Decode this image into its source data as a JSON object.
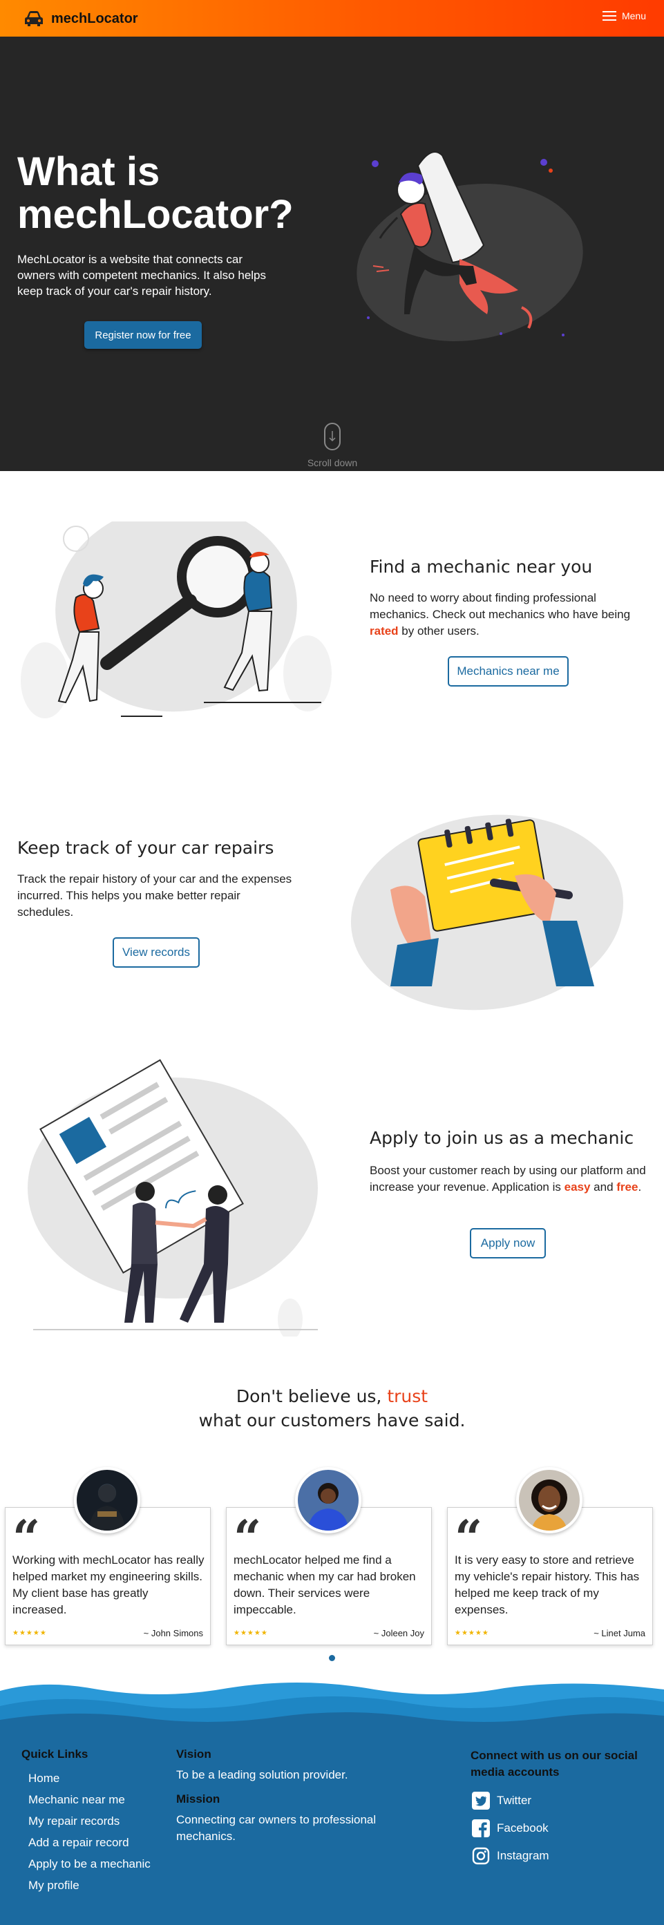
{
  "nav": {
    "brand": "mechLocator",
    "menu_label": "Menu"
  },
  "hero": {
    "title_line1": "What is",
    "title_line2": "mechLocator?",
    "description": "MechLocator is a website that connects car owners with competent mechanics. It also helps keep track of your car's repair history.",
    "cta": "Register now for free",
    "scroll_label": "Scroll down"
  },
  "find": {
    "heading": "Find a mechanic near you",
    "text_before": "No need to worry about finding professional mechanics. Check out mechanics who have being ",
    "text_highlight": "rated",
    "text_after": " by other users.",
    "button": "Mechanics near me"
  },
  "track": {
    "heading": "Keep track of your car repairs",
    "text": "Track the repair history of your car and the expenses incurred. This helps you make better repair schedules.",
    "button": "View records"
  },
  "apply": {
    "heading": "Apply to join us as a mechanic",
    "text_before": "Boost your customer reach by using our platform and increase your revenue. Application is ",
    "highlight1": "easy",
    "text_mid": " and ",
    "highlight2": "free",
    "text_after": ".",
    "button": "Apply now"
  },
  "testimonials": {
    "heading_before": "Don't believe us, ",
    "heading_highlight": "trust",
    "heading_after": " what our customers have said.",
    "quote_glyph": "“",
    "items": [
      {
        "text": "Working with mechLocator has really helped market my engineering skills. My client base has greatly increased.",
        "stars": "★★★★★",
        "author": "~ John Simons"
      },
      {
        "text": "mechLocator helped me find a mechanic when my car had broken down. Their services were impeccable.",
        "stars": "★★★★★",
        "author": "~ Joleen Joy"
      },
      {
        "text": "It is very easy to store and retrieve my vehicle's repair history. This has helped me keep track of my expenses.",
        "stars": "★★★★★",
        "author": "~ Linet Juma"
      }
    ]
  },
  "footer": {
    "quick_links_title": "Quick Links",
    "links": [
      "Home",
      "Mechanic near me",
      "My repair records",
      "Add a repair record",
      "Apply to be a mechanic",
      "My profile"
    ],
    "vision_title": "Vision",
    "vision_text": "To be a leading solution provider.",
    "mission_title": "Mission",
    "mission_text": "Connecting car owners to professional mechanics.",
    "social_title": "Connect with us on our social media accounts",
    "social": [
      {
        "label": "Twitter",
        "icon": "twitter-icon"
      },
      {
        "label": "Facebook",
        "icon": "facebook-icon"
      },
      {
        "label": "Instagram",
        "icon": "instagram-icon"
      }
    ]
  },
  "colors": {
    "accent": "#ff5a00",
    "highlight": "#e8421a",
    "primary": "#1b6aa0",
    "hero_bg": "#262626",
    "footer_bg": "#1b6aa0"
  }
}
